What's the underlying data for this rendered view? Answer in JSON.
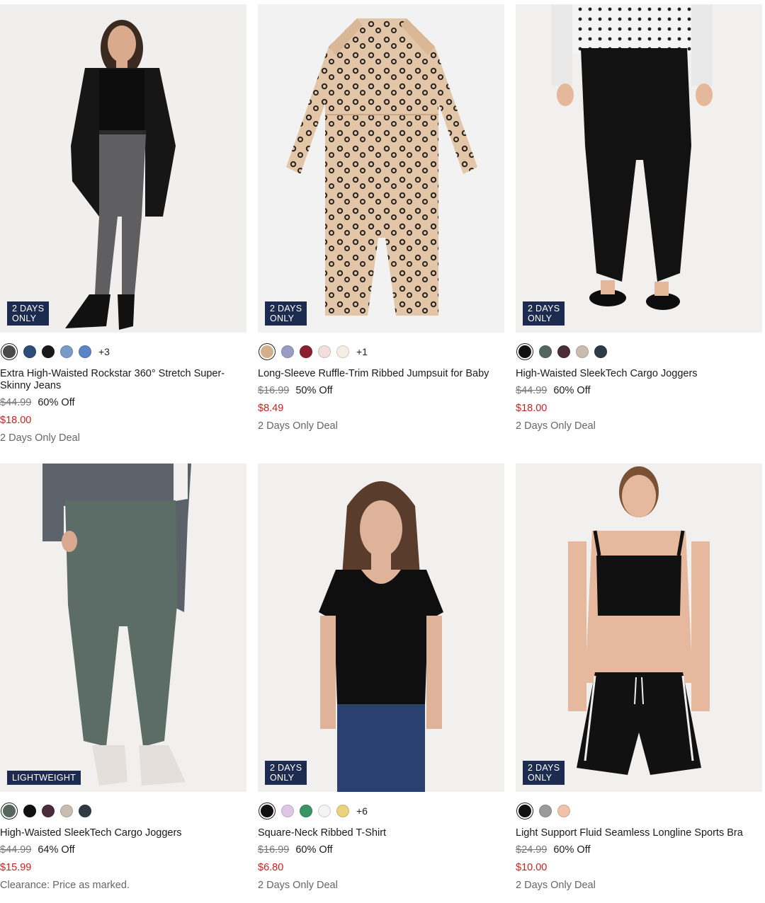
{
  "products": [
    {
      "badge_line1": "2 DAYS",
      "badge_line2": "ONLY",
      "swatches": [
        "#4a4a4a",
        "#2e4b7a",
        "#1a1a1a",
        "#7b9ac6",
        "#5b84c4"
      ],
      "more": "+3",
      "name": "Extra High-Waisted Rockstar 360° Stretch Super-Skinny Jeans",
      "original_price": "$44.99",
      "discount": "60% Off",
      "sale_price": "$18.00",
      "deal": "2 Days Only Deal"
    },
    {
      "badge_line1": "2 DAYS",
      "badge_line2": "ONLY",
      "swatches": [
        "#d2b08c",
        "#9a9cc4",
        "#8a1f2e",
        "#f3dedd",
        "#f3efe4"
      ],
      "more": "+1",
      "name": "Long-Sleeve Ruffle-Trim Ribbed Jumpsuit for Baby",
      "original_price": "$16.99",
      "discount": "50% Off",
      "sale_price": "$8.49",
      "deal": "2 Days Only Deal"
    },
    {
      "badge_line1": "2 DAYS",
      "badge_line2": "ONLY",
      "swatches": [
        "#111111",
        "#56665f",
        "#4a2d38",
        "#c9bcb0",
        "#2f3a44"
      ],
      "more": "",
      "name": "High-Waisted SleekTech Cargo Joggers",
      "original_price": "$44.99",
      "discount": "60% Off",
      "sale_price": "$18.00",
      "deal": "2 Days Only Deal"
    },
    {
      "badge_line1": "LIGHTWEIGHT",
      "badge_line2": "",
      "swatches": [
        "#56665f",
        "#111111",
        "#4a2d38",
        "#c9bcb0",
        "#2f3a44"
      ],
      "more": "",
      "name": "High-Waisted SleekTech Cargo Joggers",
      "original_price": "$44.99",
      "discount": "64% Off",
      "sale_price": "$15.99",
      "deal": "Clearance: Price as marked."
    },
    {
      "badge_line1": "2 DAYS",
      "badge_line2": "ONLY",
      "swatches": [
        "#111111",
        "#dcc7e6",
        "#3a9466",
        "#f4f4f6",
        "#ecd27c"
      ],
      "more": "+6",
      "name": "Square-Neck Ribbed T-Shirt",
      "original_price": "$16.99",
      "discount": "60% Off",
      "sale_price": "$6.80",
      "deal": "2 Days Only Deal"
    },
    {
      "badge_line1": "2 DAYS",
      "badge_line2": "ONLY",
      "swatches": [
        "#111111",
        "#9a9a9a",
        "#f0c3a8"
      ],
      "more": "",
      "name": "Light Support Fluid Seamless Longline Sports Bra",
      "original_price": "$24.99",
      "discount": "60% Off",
      "sale_price": "$10.00",
      "deal": "2 Days Only Deal"
    }
  ]
}
